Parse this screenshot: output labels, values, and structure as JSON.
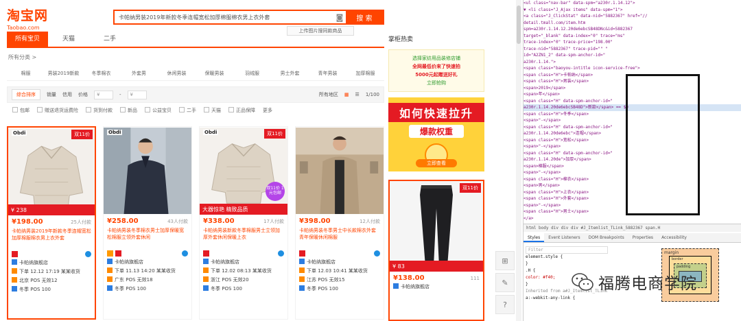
{
  "taobao": {
    "logo": "淘宝网",
    "logo_sub": "Taobao.com",
    "search_text": "卡帕纳男装2019年新款冬季连帽宽松加厚棉服棉衣男上衣外套",
    "search_button": "搜 索",
    "search_similar": "上传图片搜同款商品",
    "tabs": [
      "所有宝贝",
      "天猫",
      "二手"
    ],
    "crumb": "所有分类 >",
    "categories": [
      "棉服",
      "男装2019新款",
      "冬季棉衣",
      "外套男",
      "休闲男装",
      "保暖男装",
      "羽绒服",
      "男士外套",
      "青年男装",
      "加厚棉服"
    ],
    "sort": [
      "综合排序",
      "销量",
      "信用",
      "价格",
      "¥",
      "-",
      "¥"
    ],
    "sort_right": [
      "所有地区",
      "1/100"
    ],
    "filters": [
      "包邮",
      "赠送退货运费险",
      "货到付款",
      "新品",
      "公益宝贝",
      "二手",
      "天猫",
      "正品保障"
    ],
    "filters_more": "更多",
    "products": [
      {
        "brand": "Obdi",
        "tag": "双11价",
        "promo": "¥ 238",
        "bubble": "",
        "price": "¥198.00",
        "sold": "25人付款",
        "title": "卡帕纳男装2019年新款冬季连帽宽松加厚棉服棉衣男上衣外套",
        "store": "卡帕纳旗舰店",
        "meta2": "下单 12.12 17:19 某某收货",
        "meta3": "北京 POS 无效12",
        "meta4": "冬季 POS 100"
      },
      {
        "brand": "Obdi",
        "tag": "",
        "promo": "",
        "bubble": "",
        "price": "¥258.00",
        "sold": "43人付款",
        "title": "卡帕纳男装冬季棉衣男士加厚保暖宽松棉服立领外套休闲",
        "store": "卡帕纳旗舰店",
        "meta2": "下单 11.13 14:20 某某收货",
        "meta3": "广东 POS 无效18",
        "meta4": "冬季 POS 100"
      },
      {
        "brand": "Obdi",
        "tag": "双11价",
        "promo": "大器惊艳 精致品质",
        "bubble": "双11价 1元包邮",
        "price": "¥338.00",
        "sold": "17人付款",
        "title": "卡帕纳男装新款冬季棉服男士立领加厚外套休闲保暖上衣",
        "store": "卡帕纳旗舰店",
        "meta2": "下单 12.02 08:13 某某收货",
        "meta3": "浙江 POS 无效20",
        "meta4": "冬季 POS 100"
      },
      {
        "brand": "",
        "tag": "",
        "promo": "",
        "bubble": "",
        "price": "¥398.00",
        "sold": "12人付款",
        "title": "卡帕纳男装冬季男士中长款棉衣外套青年保暖休闲棉服",
        "store": "卡帕纳旗舰店",
        "meta2": "下单 12.03 10:41 某某收货",
        "meta3": "江苏 POS 无效15",
        "meta4": "冬季 POS 100"
      }
    ],
    "ad_title": "掌柜热卖",
    "ad1_lines": [
      "选择家纺用品装修店铺",
      "全网最低价来了快速拍",
      "5000元起赠送好礼",
      "立即抢购"
    ],
    "ad2_title": "如何快速拉升",
    "ad2_sub": "爆款权重",
    "ad2_button": "立即查看",
    "ad3": {
      "tag": "双11价",
      "promo": "¥ 83",
      "price": "¥138.00",
      "sold": "111",
      "store": "卡帕纳旗舰店"
    },
    "float_tools": [
      "⊞",
      "✎",
      "?"
    ]
  },
  "devtools": {
    "lines": [
      "<ul class=\"nav-bar\" data-spm=\"a230r.1.14.12\">",
      "▼ <li class=\"J_Ajax items\" data-spm=\"1\">",
      "  <a class=\"J_ClickStat\" data-nid=\"5882367\" href=\"//",
      "  detail.tmall.com/item.htm",
      "  spm=a230r.1.14.12.20de6ebcSB48DNc&id=5882367",
      "  target=\"_blank\" data-index=\"0\" trace=\"ms\"",
      "  trace-index=\"0\" trace-price=\"198.00\"",
      "  trace-nid=\"5882367\" trace-pid=\"\" \"",
      "  id=\"A2ZN1_2\" data-spm-anchor-id=\"",
      "  a230r.1.14.\">",
      "  <span class=\"baoyou-intitle icon-service-free\">",
      "    <span class=\"H\">卡帕纳</span>",
      "    <span class=\"H\">男装</span>",
      "    <span>2019</span>",
      "    <span>年</span>",
      "    <span class=\"H\" data-spm-anchor-id=\"",
      "    a230r.1.14.20de6ebcSB48D\">新款</span> == $0",
      "    <span class=\"H\">冬季</span>",
      "    <span>\"-</span>",
      "    <span class=\"H\" data-spm-anchor-id=\"",
      "    a230r.1.14.20de6ebc\">连帽</span>",
      "    <span class=\"H\">宽松</span>",
      "    <span>\"-</span>",
      "    <span class=\"H\" data-spm-anchor-id=\"",
      "    a230r.1.14.20de\">加厚</span>",
      "    <span>棉服</span>",
      "    <span>\"-</span>",
      "    <span class=\"H\">棉衣</span>",
      "    <span>男</span>",
      "    <span class=\"H\">上衣</span>",
      "    <span class=\"H\">外套</span>",
      "    <span>\"-</span>",
      "    <span class=\"H\">男士</span>",
      "  </a>"
    ],
    "selected_index": 16,
    "crumb": "html  body  div  div  div  #J_Itemlist_TLink_5882367  span.H",
    "tabs": [
      "Styles",
      "Event Listeners",
      "DOM Breakpoints",
      "Properties",
      "Accessibility"
    ],
    "styles_filter": "Filter",
    "style_lines": [
      "element.style {",
      "}",
      ".H {",
      "  color: #f40;",
      "}",
      "Inherited from a#J_Itemlist_TLink",
      "a:-webkit-any-link {"
    ],
    "box_labels": {
      "margin": "margin",
      "border": "border",
      "padding": "padding"
    }
  },
  "watermark": "福腾电商学院"
}
